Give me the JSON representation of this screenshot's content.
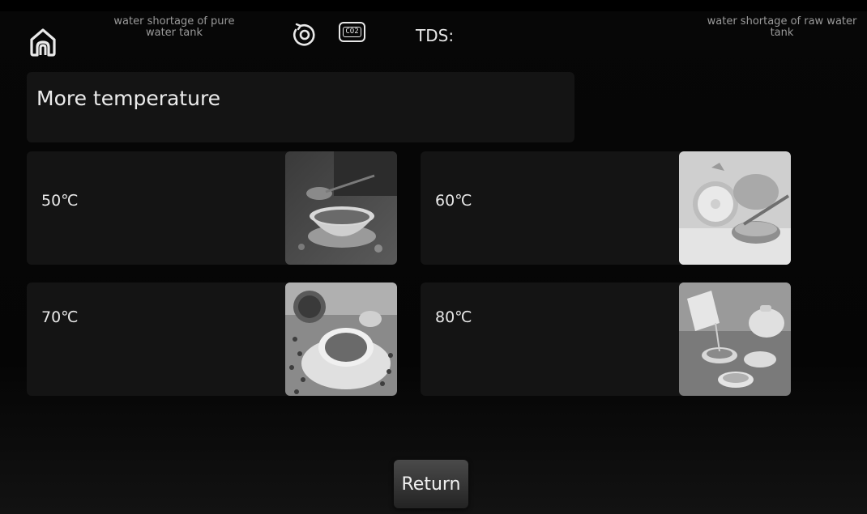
{
  "status": {
    "pure_tank": "water shortage of pure water tank",
    "raw_tank": "water shortage of raw water tank",
    "co2_label": "CO2",
    "tds_label": "TDS:"
  },
  "icons": {
    "home": "home-icon",
    "ring": "filter-ring-icon",
    "co2": "co2-icon"
  },
  "page": {
    "title": "More temperature",
    "return_label": "Return"
  },
  "options": [
    {
      "label": "50℃",
      "image": "tea-cup-photo"
    },
    {
      "label": "60℃",
      "image": "lemon-honey-photo"
    },
    {
      "label": "70℃",
      "image": "beans-soup-photo"
    },
    {
      "label": "80℃",
      "image": "teapot-photo"
    }
  ]
}
